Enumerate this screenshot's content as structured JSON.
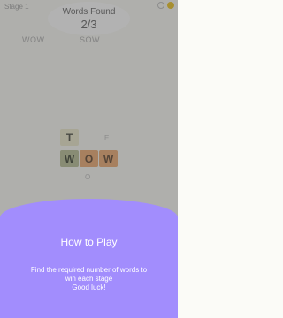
{
  "header": {
    "stage_label": "Stage 1",
    "coins": [
      {
        "icon": "coin-outline-icon",
        "color": "#c9c9c9"
      },
      {
        "icon": "coin-gold-icon",
        "color": "#f0cd45"
      }
    ]
  },
  "progress": {
    "title": "Words Found",
    "count": "2/3"
  },
  "found_words": [
    "WOW",
    "SOW"
  ],
  "board": {
    "highlighted_word": [
      "W",
      "O",
      "W"
    ],
    "tiles": [
      "T",
      "W",
      "O",
      "W"
    ],
    "dim_letters": [
      "E",
      "O"
    ]
  },
  "tutorial": {
    "title": "How to Play",
    "body_lines": [
      "Find the required number of words to",
      "win each stage",
      "Good luck!"
    ],
    "background_color": "#a28dfd"
  }
}
